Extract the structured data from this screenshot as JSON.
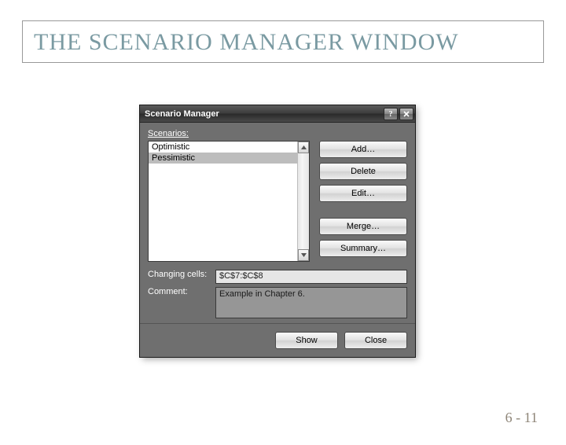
{
  "slide": {
    "title": "THE SCENARIO MANAGER WINDOW",
    "page": "6 - 11"
  },
  "dialog": {
    "title": "Scenario Manager",
    "scenarios_label": "Scenarios:",
    "items": {
      "0": {
        "label": "Optimistic"
      },
      "1": {
        "label": "Pessimistic"
      }
    },
    "buttons": {
      "add": "Add…",
      "delete": "Delete",
      "edit": "Edit…",
      "merge": "Merge…",
      "summary": "Summary…"
    },
    "changing_cells_label": "Changing cells:",
    "changing_cells_value": "$C$7:$C$8",
    "comment_label": "Comment:",
    "comment_value": "Example in Chapter 6.",
    "footer": {
      "show": "Show",
      "close": "Close"
    }
  }
}
